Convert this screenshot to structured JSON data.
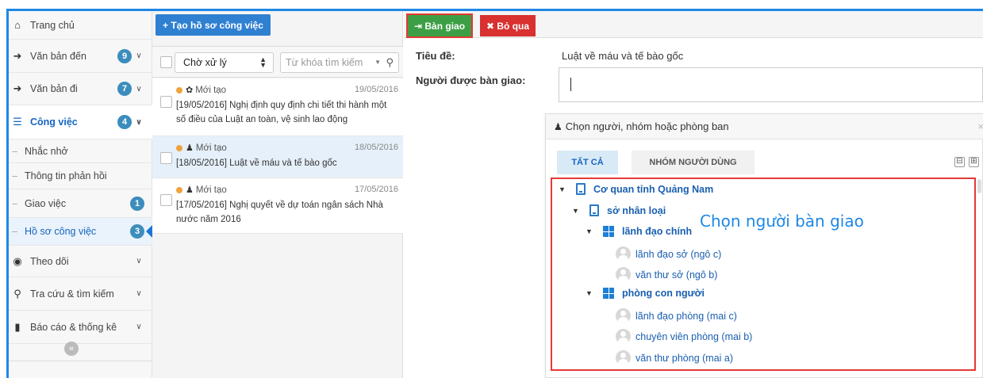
{
  "sidebar": {
    "items": [
      {
        "label": "Trang chủ",
        "icon": "home-icon",
        "glyph": "⌂"
      },
      {
        "label": "Văn bản đến",
        "icon": "incoming-docs-icon",
        "glyph": "➜",
        "badge": "9"
      },
      {
        "label": "Văn bản đi",
        "icon": "outgoing-docs-icon",
        "glyph": "➜",
        "badge": "7"
      },
      {
        "label": "Công việc",
        "icon": "tasks-icon",
        "glyph": "☰",
        "badge": "4"
      },
      {
        "label": "Theo dõi",
        "icon": "eye-icon",
        "glyph": "◉"
      },
      {
        "label": "Tra cứu & tìm kiếm",
        "icon": "search-icon",
        "glyph": "⚲"
      },
      {
        "label": "Báo cáo & thống kê",
        "icon": "bar-chart-icon",
        "glyph": "▮"
      }
    ],
    "sub_items": [
      {
        "label": "Nhắc nhở"
      },
      {
        "label": "Thông tin phản hồi"
      },
      {
        "label": "Giao việc",
        "badge": "1"
      },
      {
        "label": "Hồ sơ công việc",
        "badge": "3"
      }
    ],
    "collapse_glyph": "«"
  },
  "list": {
    "create_label": "+ Tạo hồ sơ công việc",
    "status_value": "Chờ xử lý",
    "search_placeholder": "Từ khóa tìm kiếm",
    "items": [
      {
        "status": "Mới tạo",
        "type_glyph": "✿",
        "date": "19/05/2016",
        "title": "[19/05/2016] Nghị định quy định chi tiết thi hành một số điều của Luật an toàn, vệ sinh lao động"
      },
      {
        "status": "Mới tạo",
        "type_glyph": "♟",
        "date": "18/05/2016",
        "title": "[18/05/2016] Luật về máu và tế bào gốc"
      },
      {
        "status": "Mới tạo",
        "type_glyph": "♟",
        "date": "17/05/2016",
        "title": "[17/05/2016] Nghị quyết về dự toán ngân sách Nhà nước năm 2016"
      }
    ]
  },
  "detail": {
    "handover_label": "⇥ Bàn giao",
    "skip_label": "✖ Bỏ qua",
    "title_label": "Tiêu đề:",
    "title_value": "Luật về máu và tế bào gốc",
    "receiver_label": "Người được bàn giao:"
  },
  "picker": {
    "heading": "Chọn người, nhóm hoặc phòng ban",
    "tabs": [
      "TẤT CẢ",
      "NHÓM NGƯỜI DÙNG"
    ],
    "collapse_all": "⊟",
    "expand_all": "⊞",
    "close_glyph": "×",
    "tree": [
      {
        "label": "Cơ quan tỉnh Quảng Nam",
        "kind": "org"
      },
      {
        "label": "sở nhân loại",
        "kind": "org"
      },
      {
        "label": "lãnh đạo chính",
        "kind": "group"
      },
      {
        "label": "lãnh đạo sở (ngô c)",
        "kind": "person"
      },
      {
        "label": "văn thư sở (ngô b)",
        "kind": "person"
      },
      {
        "label": "phòng con người",
        "kind": "group"
      },
      {
        "label": "lãnh đạo phòng (mai c)",
        "kind": "person"
      },
      {
        "label": "chuyên viên phòng (mai b)",
        "kind": "person"
      },
      {
        "label": "văn thư phòng (mai a)",
        "kind": "person"
      }
    ],
    "annotation": "Chọn người bàn giao"
  },
  "colors": {
    "accent": "#1e88e5",
    "handover_button": "#3d9f45",
    "skip_button": "#d93030",
    "badge": "#3c8dbc",
    "highlight_box": "#e53935"
  }
}
